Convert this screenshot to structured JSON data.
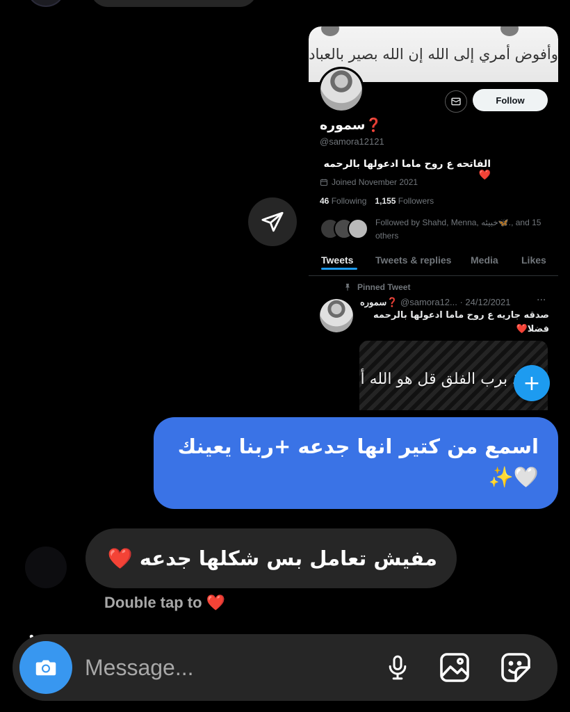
{
  "profile_card": {
    "banner_text": "وأفوض أمري إلى الله إن الله بصير بالعباد",
    "follow_label": "Follow",
    "name": "سموره❓",
    "handle": "@samora12121",
    "bio": "الفاتحه ع روح ماما ادعولها بالرحمه❤️",
    "joined": "Joined November 2021",
    "following_count": "46",
    "following_label": "Following",
    "followers_count": "1,155",
    "followers_label": "Followers",
    "followed_by": "Followed by Shahd, Menna, خبيئه🦋., and 15 others",
    "tabs": [
      {
        "label": "Tweets"
      },
      {
        "label": "Tweets & replies"
      },
      {
        "label": "Media"
      },
      {
        "label": "Likes"
      }
    ],
    "pinned_label": "Pinned Tweet",
    "tweet": {
      "author": "سموره❓",
      "handle_date": "@samora12... · 24/12/2021",
      "more": "···",
      "text": "صدقه جاريه ع روح ماما ادعولها بالرحمه فضلا❤️",
      "image_text": "قل أعوذ برب الفلق    قل هو الله أحد"
    },
    "fab_label": "+"
  },
  "messages": {
    "outgoing": "اسمع من كتير انها جدعه +ربنا يعينك 🤍✨",
    "incoming": "مفيش تعامل بس شكلها جدعه ❤️",
    "double_tap_hint": "Double tap to ❤️",
    "typing_indicator": "• • •"
  },
  "composer": {
    "placeholder": "Message..."
  },
  "colors": {
    "outgoing_bubble": "#3a73e6",
    "incoming_bubble": "#262626",
    "camera_button": "#3897f0",
    "twitter_blue": "#1d9bf0"
  },
  "icons": {
    "share": "paper-plane-icon",
    "camera": "camera-icon",
    "mic": "microphone-icon",
    "gallery": "image-icon",
    "sticker": "sticker-icon",
    "mail": "envelope-icon",
    "calendar": "calendar-icon",
    "pin": "pin-icon"
  }
}
